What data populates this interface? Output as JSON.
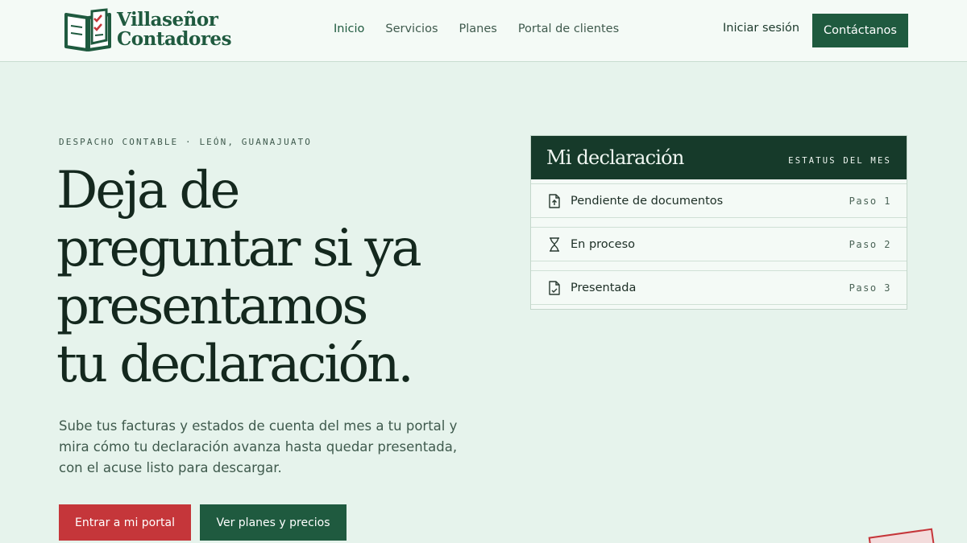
{
  "brand": {
    "line1": "Villaseñor",
    "line2": "Contadores"
  },
  "nav": [
    {
      "label": "Inicio",
      "active": true
    },
    {
      "label": "Servicios",
      "active": false
    },
    {
      "label": "Planes",
      "active": false
    },
    {
      "label": "Portal de clientes",
      "active": false
    }
  ],
  "header": {
    "login_label": "Iniciar sesión",
    "contact_label": "Contáctanos"
  },
  "hero": {
    "eyebrow": "DESPACHO CONTABLE · LEÓN, GUANAJUATO",
    "headline_lines": [
      "Deja de",
      "preguntar si ya",
      "presentamos",
      "tu declaración."
    ],
    "subtitle_lines": [
      "Sube tus facturas y estados de cuenta del mes a tu portal y",
      "mira cómo tu declaración avanza hasta quedar presentada,",
      "con el acuse listo para descargar."
    ],
    "primary_cta": "Entrar a mi portal",
    "secondary_cta": "Ver planes y precios"
  },
  "status_card": {
    "title": "Mi declaración",
    "kicker": "ESTATUS DEL MES",
    "rows": [
      {
        "icon": "document-upload-icon",
        "label": "Pendiente de documentos",
        "step": "Paso 1"
      },
      {
        "icon": "hourglass-icon",
        "label": "En proceso",
        "step": "Paso 2"
      },
      {
        "icon": "document-check-icon",
        "label": "Presentada",
        "step": "Paso 3"
      }
    ]
  },
  "colors": {
    "brand_green": "#1f5a3f",
    "dark_green": "#163a2a",
    "accent_red": "#c5363a",
    "background": "#e6f3ec"
  }
}
